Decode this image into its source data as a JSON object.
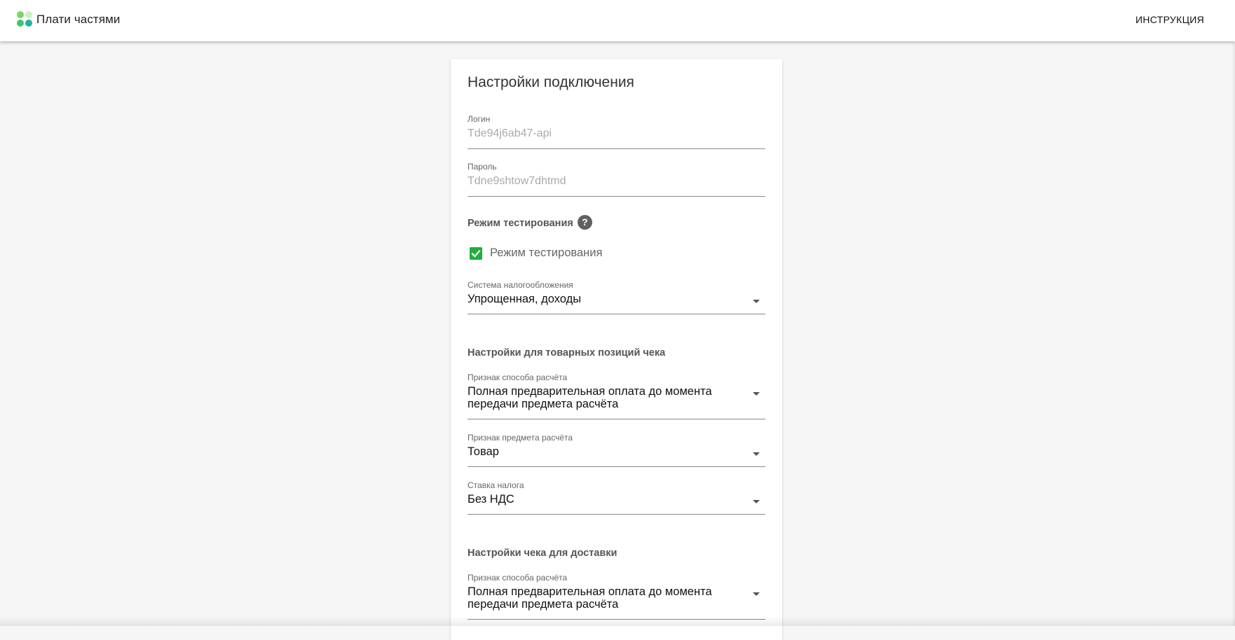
{
  "header": {
    "brand": "Плати частями",
    "instruction_link": "ИНСТРУКЦИЯ"
  },
  "colors": {
    "logo": [
      "#7dd36b",
      "#c9f0c3",
      "#3cc86a",
      "#1cb59a"
    ],
    "checkbox": "#1fae3c"
  },
  "card": {
    "title": "Настройки подключения",
    "login": {
      "label": "Логин",
      "value": "Tde94j6ab47-api"
    },
    "password": {
      "label": "Пароль",
      "value": "Tdne9shtow7dhtmd"
    },
    "test_mode": {
      "heading": "Режим тестирования",
      "help_icon": "question-circle-icon",
      "help_glyph": "?",
      "checkbox_label": "Режим тестирования",
      "checked": true
    },
    "tax_system": {
      "label": "Система налогообложения",
      "value": "Упрощенная, доходы"
    },
    "items_section": {
      "heading": "Настройки для товарных позиций чека",
      "payment_method": {
        "label": "Признак способа расчёта",
        "value": "Полная предварительная оплата до момента передачи предмета расчёта"
      },
      "payment_object": {
        "label": "Признак предмета расчёта",
        "value": "Товар"
      },
      "tax_rate": {
        "label": "Ставка налога",
        "value": "Без НДС"
      }
    },
    "delivery_section": {
      "heading": "Настройки чека для доставки",
      "payment_method": {
        "label": "Признак способа расчёта",
        "value": "Полная предварительная оплата до момента передачи предмета расчёта"
      }
    }
  }
}
